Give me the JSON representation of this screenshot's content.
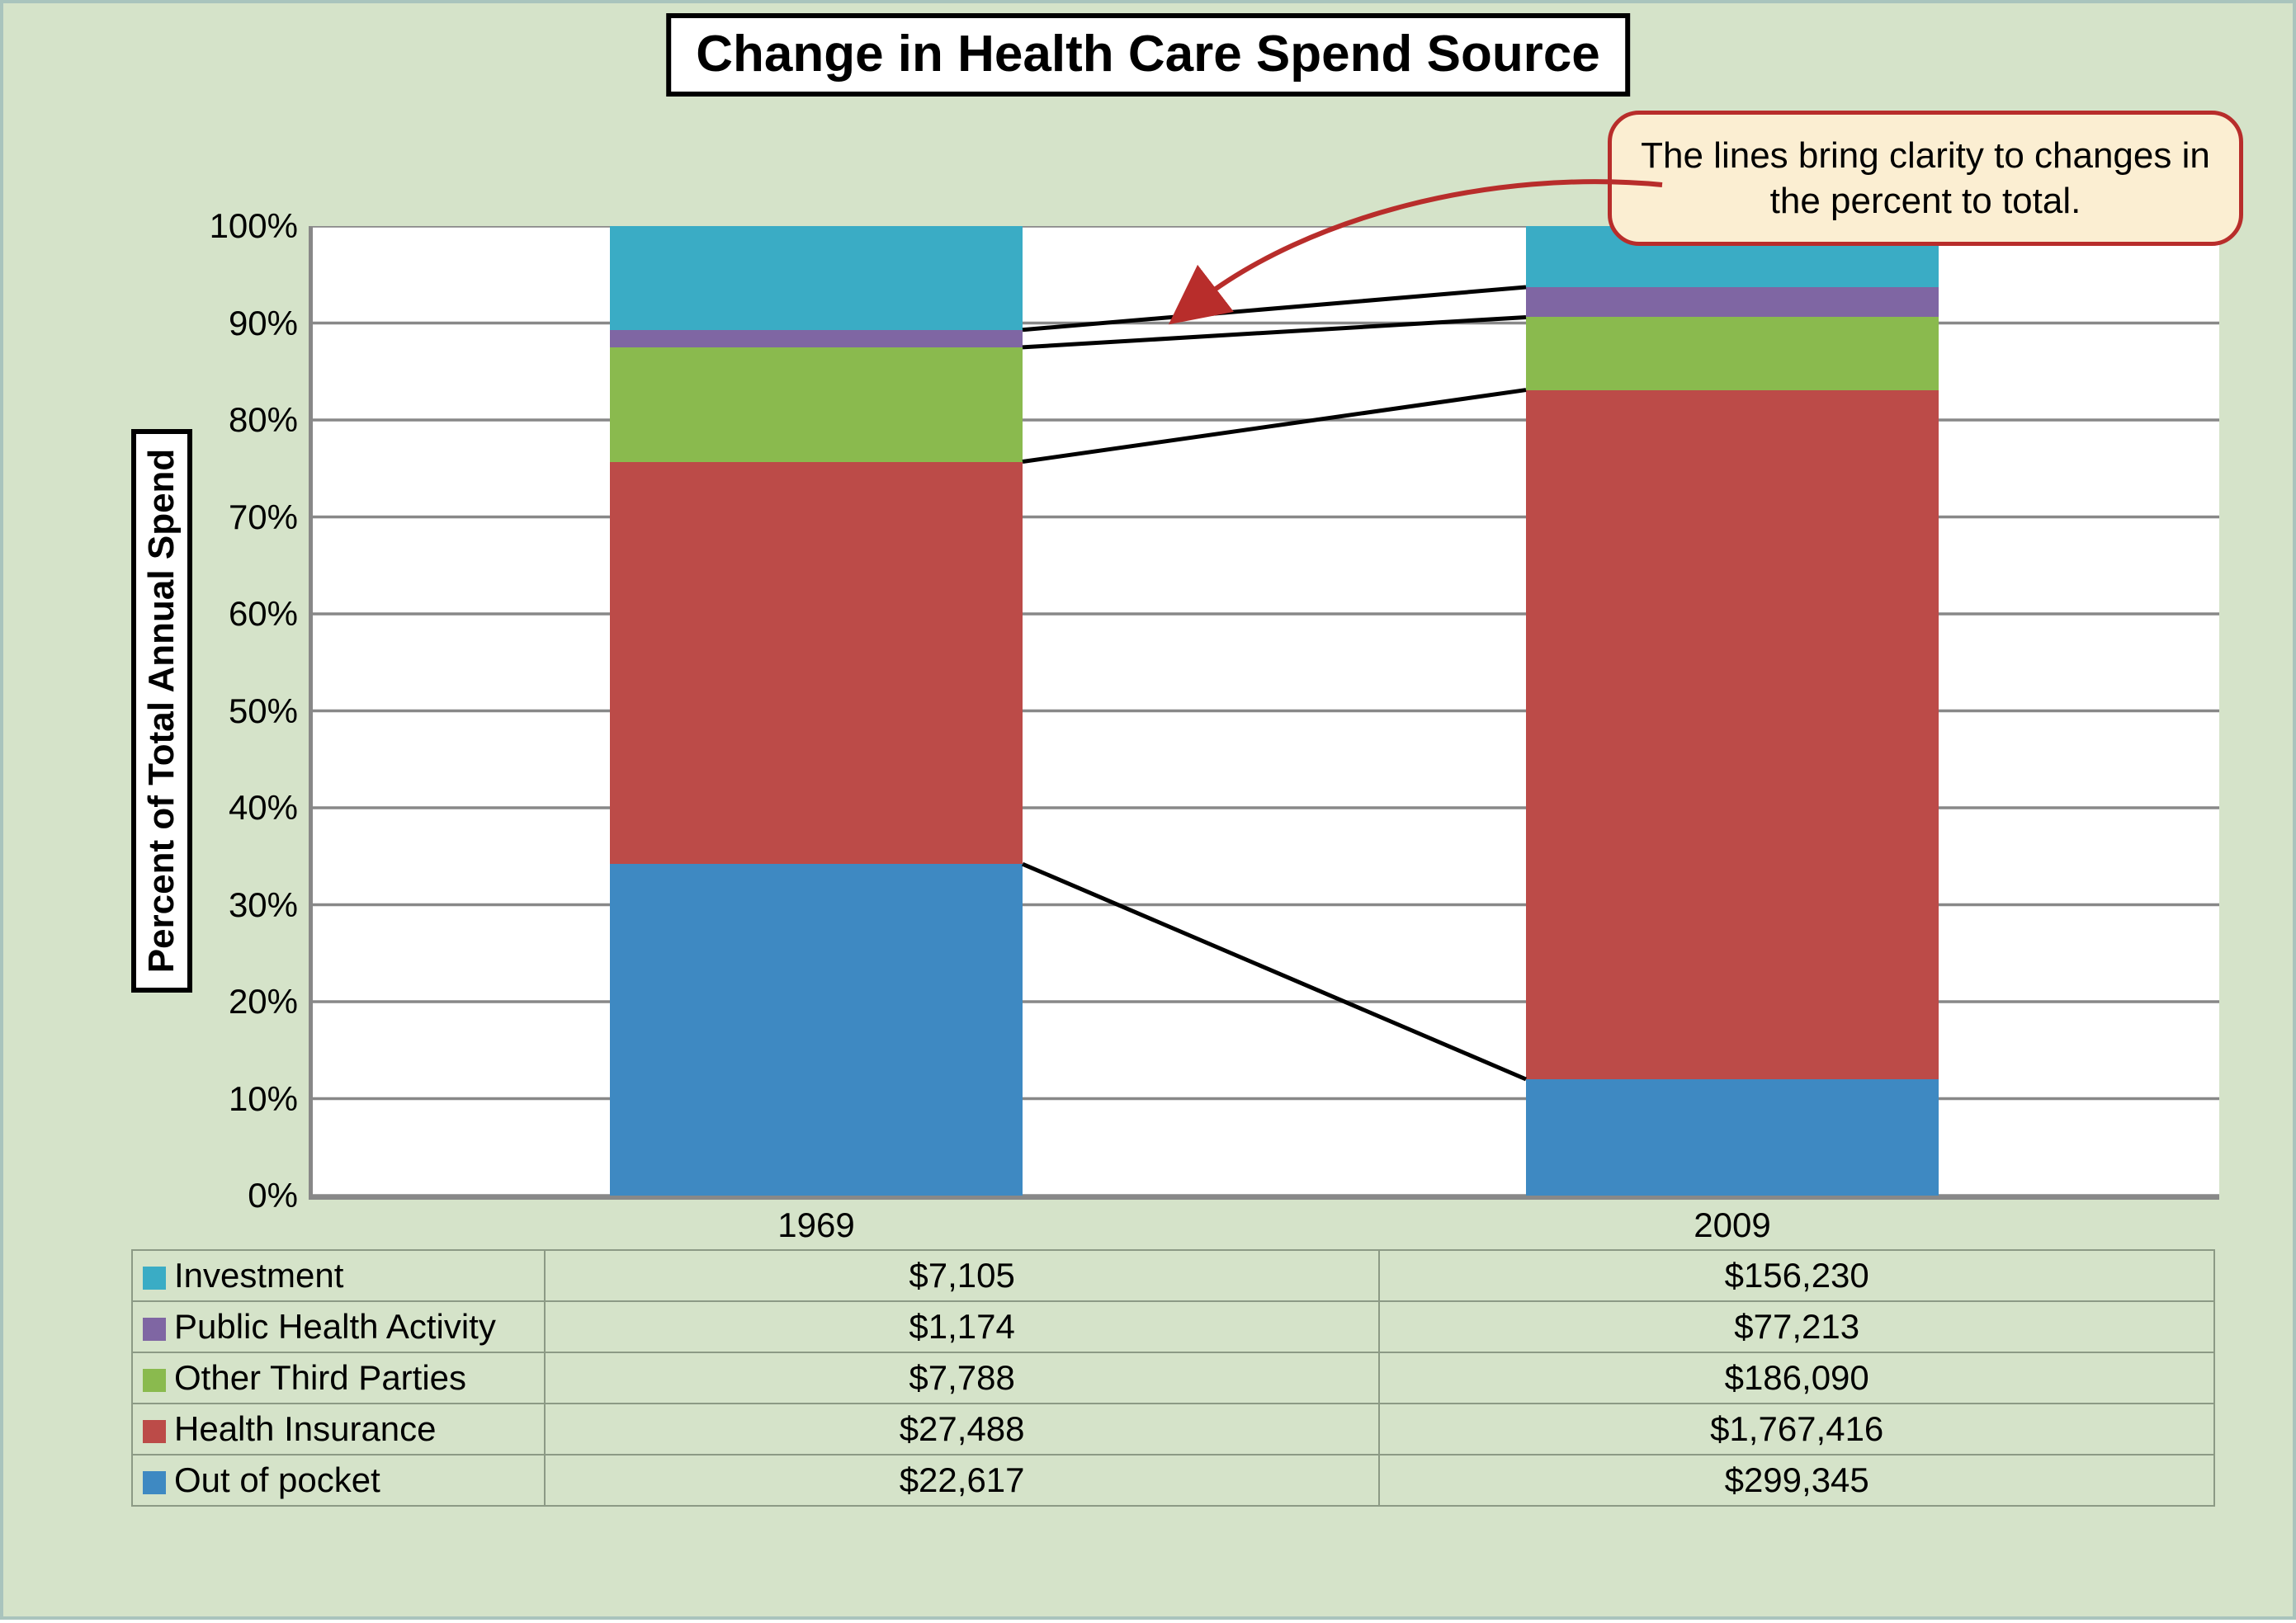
{
  "title": "Change in Health Care Spend Source",
  "y_axis_label": "Percent of Total Annual Spend",
  "callout_text": "The lines bring clarity to changes in the percent to total.",
  "categories": [
    "1969",
    "2009"
  ],
  "y_ticks": [
    "0%",
    "10%",
    "20%",
    "30%",
    "40%",
    "50%",
    "60%",
    "70%",
    "80%",
    "90%",
    "100%"
  ],
  "series": [
    {
      "name": "Investment",
      "color_class": "c-inv",
      "values_label": [
        "$7,105",
        "$156,230"
      ]
    },
    {
      "name": "Public Health Activity",
      "color_class": "c-pub",
      "values_label": [
        "$1,174",
        "$77,213"
      ]
    },
    {
      "name": "Other Third Parties",
      "color_class": "c-oth",
      "values_label": [
        "$7,788",
        "$186,090"
      ]
    },
    {
      "name": "Health Insurance",
      "color_class": "c-ins",
      "values_label": [
        "$27,488",
        "$1,767,416"
      ]
    },
    {
      "name": "Out of pocket",
      "color_class": "c-out",
      "values_label": [
        "$22,617",
        "$299,345"
      ]
    }
  ],
  "chart_data": {
    "type": "stacked-bar-100pct",
    "title": "Change in Health Care Spend Source",
    "ylabel": "Percent of Total Annual Spend",
    "ylim": [
      0,
      100
    ],
    "categories": [
      "1969",
      "2009"
    ],
    "stack_order_bottom_to_top": [
      "Out of pocket",
      "Health Insurance",
      "Other Third Parties",
      "Public Health Activity",
      "Investment"
    ],
    "series": [
      {
        "name": "Out of pocket",
        "raw_values": [
          22617,
          299345
        ],
        "percent": [
          34.2,
          12.0
        ]
      },
      {
        "name": "Health Insurance",
        "raw_values": [
          27488,
          1767416
        ],
        "percent": [
          41.5,
          71.1
        ]
      },
      {
        "name": "Other Third Parties",
        "raw_values": [
          7788,
          186090
        ],
        "percent": [
          11.8,
          7.5
        ]
      },
      {
        "name": "Public Health Activity",
        "raw_values": [
          1174,
          77213
        ],
        "percent": [
          1.8,
          3.1
        ]
      },
      {
        "name": "Investment",
        "raw_values": [
          7105,
          156230
        ],
        "percent": [
          10.7,
          6.3
        ]
      }
    ],
    "annotation": "The lines bring clarity to changes in the percent to total."
  }
}
